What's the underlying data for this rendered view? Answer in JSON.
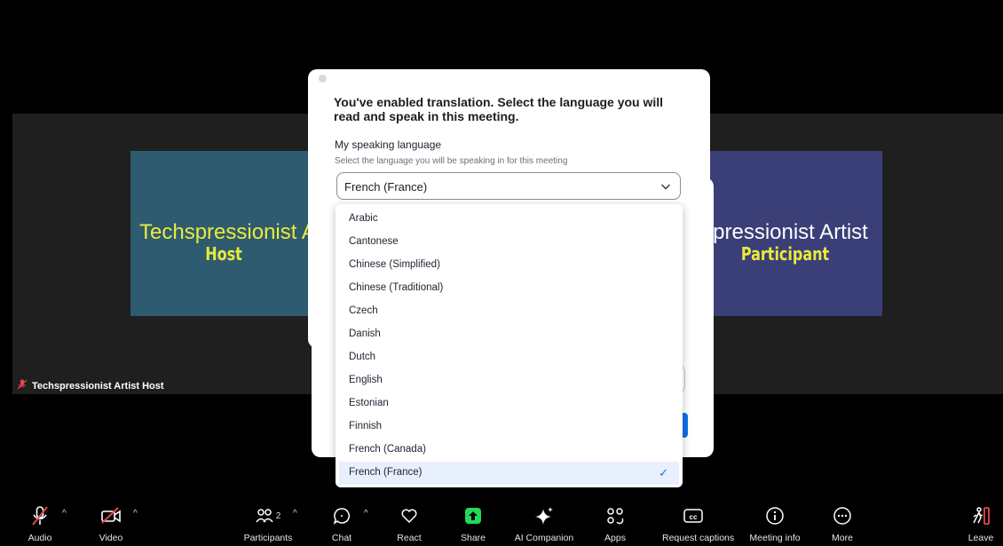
{
  "video": {
    "host_tile": {
      "name": "Techspressionist A",
      "role": "Host"
    },
    "participant_tile": {
      "name": "spressionist Artist",
      "role": "Participant"
    },
    "host_label": "Techspressionist Artist Host"
  },
  "dialog": {
    "title": "You've enabled translation. Select the language you will read and speak in this meeting.",
    "speaking_label": "My speaking language",
    "speaking_help": "Select the language you will be speaking in for this meeting",
    "selected_language": "French (France)"
  },
  "dropdown": {
    "options": [
      "Arabic",
      "Cantonese",
      "Chinese (Simplified)",
      "Chinese (Traditional)",
      "Czech",
      "Danish",
      "Dutch",
      "English",
      "Estonian",
      "Finnish",
      "French (Canada)",
      "French (France)"
    ],
    "selected_index": 11
  },
  "toolbar": {
    "audio": "Audio",
    "video": "Video",
    "participants": "Participants",
    "participants_count": "2",
    "chat": "Chat",
    "react": "React",
    "share": "Share",
    "ai_companion": "AI Companion",
    "apps": "Apps",
    "request_captions": "Request captions",
    "meeting_info": "Meeting info",
    "more": "More",
    "leave": "Leave"
  },
  "colors": {
    "accent": "#0e72ed",
    "host_tile": "#2e5b6f",
    "participant_tile": "#3b3f77",
    "muted_red": "#e5484d",
    "share_green": "#23d959",
    "tile_text_yellow": "#eaeb3a"
  },
  "icons": {
    "audio": "muted-microphone-icon",
    "video": "video-off-icon",
    "participants": "participants-icon",
    "chat": "chat-icon",
    "react": "heart-icon",
    "share": "share-arrow-icon",
    "ai_companion": "sparkle-icon",
    "apps": "apps-icon",
    "request_captions": "cc-icon",
    "meeting_info": "info-icon",
    "more": "more-icon",
    "leave": "leave-icon",
    "check": "checkmark-icon",
    "chevron": "chevron-down-icon"
  }
}
